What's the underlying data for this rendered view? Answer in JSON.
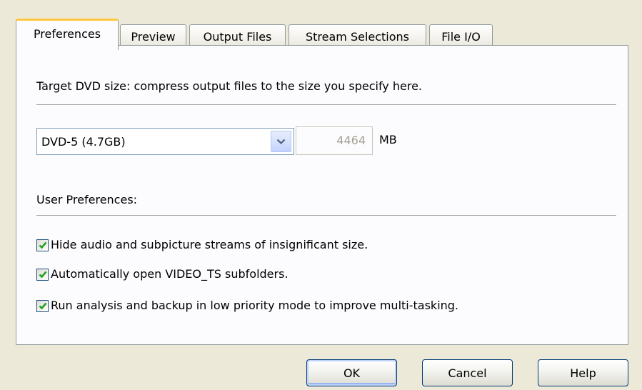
{
  "tabs": [
    {
      "label": "Preferences",
      "active": true
    },
    {
      "label": "Preview",
      "active": false
    },
    {
      "label": "Output Files",
      "active": false
    },
    {
      "label": "Stream Selections",
      "active": false
    },
    {
      "label": "File I/O",
      "active": false
    }
  ],
  "panel": {
    "description": "Target DVD size: compress output files to the size you specify here.",
    "dvd_size": {
      "selected": "DVD-5 (4.7GB)",
      "size_value": "4464",
      "size_unit": "MB"
    },
    "user_prefs_label": "User Preferences:",
    "options": [
      {
        "label": "Hide audio and subpicture streams of insignificant size.",
        "checked": true
      },
      {
        "label": "Automatically open VIDEO_TS subfolders.",
        "checked": true
      },
      {
        "label": "Run analysis and backup in low priority mode to improve multi-tasking.",
        "checked": true
      }
    ]
  },
  "buttons": {
    "ok": "OK",
    "cancel": "Cancel",
    "help": "Help"
  },
  "colors": {
    "dialog_bg": "#ece9d8",
    "panel_bg": "#fcfcfe",
    "active_tab_accent": "#ffc83c",
    "check_mark": "#21a121",
    "button_border": "#003c74"
  }
}
